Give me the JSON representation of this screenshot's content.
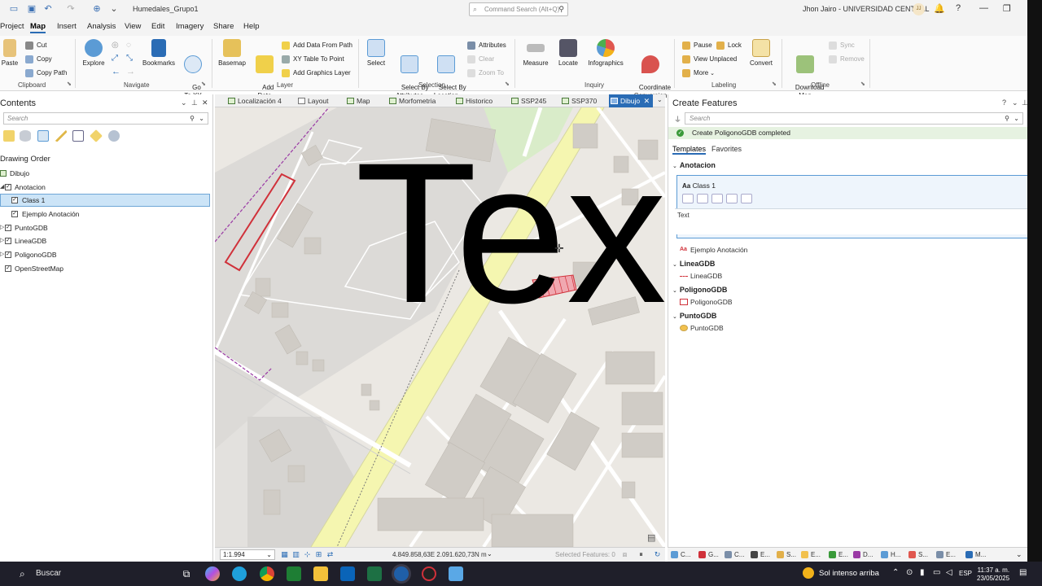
{
  "window": {
    "title": "Humedales_Grupo1",
    "command_search_placeholder": "Command Search (Alt+Q)",
    "user": "Jhon Jairo - UNIVERSIDAD CENTRAL",
    "user_initials": "JJ",
    "help": "?"
  },
  "menu": [
    "Project",
    "Map",
    "Insert",
    "Analysis",
    "View",
    "Edit",
    "Imagery",
    "Share",
    "Help"
  ],
  "ribbon": {
    "clipboard": {
      "label": "Clipboard",
      "paste": "Paste",
      "cut": "Cut",
      "copy": "Copy",
      "copy_path": "Copy Path"
    },
    "navigate": {
      "label": "Navigate",
      "explore": "Explore",
      "bookmarks": "Bookmarks",
      "go_to_xy": "Go\nTo XY"
    },
    "layer": {
      "label": "Layer",
      "basemap": "Basemap",
      "add_data": "Add\nData",
      "add_data_from_path": "Add Data From Path",
      "xy_table_to_point": "XY Table To Point",
      "add_graphics_layer": "Add Graphics Layer"
    },
    "selection": {
      "label": "Selection",
      "select": "Select",
      "select_by_attributes": "Select By\nAttributes",
      "select_by_location": "Select By\nLocation",
      "attributes": "Attributes",
      "clear": "Clear",
      "zoom_to": "Zoom To"
    },
    "inquiry": {
      "label": "Inquiry",
      "measure": "Measure",
      "locate": "Locate",
      "infographics": "Infographics",
      "coordinate_conversion": "Coordinate\nConversion"
    },
    "labeling": {
      "label": "Labeling",
      "pause": "Pause",
      "lock": "Lock",
      "view_unplaced": "View Unplaced",
      "more": "More",
      "convert": "Convert"
    },
    "offline": {
      "label": "Offline",
      "download_map": "Download\nMap",
      "sync": "Sync",
      "remove": "Remove"
    }
  },
  "contents": {
    "title": "Contents",
    "search_placeholder": "Search",
    "drawing_order": "Drawing Order",
    "layers": {
      "dibujo": "Dibujo",
      "anotacion": "Anotacion",
      "class1": "Class 1",
      "ejemplo": "Ejemplo Anotación",
      "punto": "PuntoGDB",
      "linea": "LineaGDB",
      "poligono": "PoligonoGDB",
      "osm": "OpenStreetMap"
    }
  },
  "map_tabs": [
    "Localización 4",
    "Layout",
    "Map",
    "Morfometria",
    "Historico",
    "SSP245",
    "SSP370",
    "Dibujo"
  ],
  "map": {
    "annotation_text": "Tex",
    "scale": "1:1.994",
    "coordinates": "4.849.858,63E 2.091.620,73N m",
    "selected_features": "Selected Features: 0"
  },
  "create_features": {
    "title": "Create Features",
    "search_placeholder": "Search",
    "status": "Create PoligonoGDB completed",
    "tabs": [
      "Templates",
      "Favorites"
    ],
    "group_anotacion": "Anotacion",
    "class1": "Class 1",
    "class1_text": "Text",
    "ejemplo": "Ejemplo Anotación",
    "group_linea": "LineaGDB",
    "linea_item": "LineaGDB",
    "group_poligono": "PoligonoGDB",
    "poligono_item": "PoligonoGDB",
    "group_punto": "PuntoGDB",
    "punto_item": "PuntoGDB"
  },
  "bottom_strip": [
    "C...",
    "G...",
    "C...",
    "E...",
    "S...",
    "E...",
    "E...",
    "D...",
    "H...",
    "S...",
    "E...",
    "M..."
  ],
  "taskbar": {
    "search": "Buscar",
    "weather": "Sol intenso arriba",
    "lang": "ESP",
    "time": "11:37 a. m.",
    "date": "23/05/2025"
  },
  "colors": {
    "accent": "#2a6cb5",
    "selection_highlight": "#cce4f7",
    "status_ok": "#3a9a3a",
    "polygon_outline": "#d0313a",
    "road_yellow": "#f7f9b8"
  }
}
